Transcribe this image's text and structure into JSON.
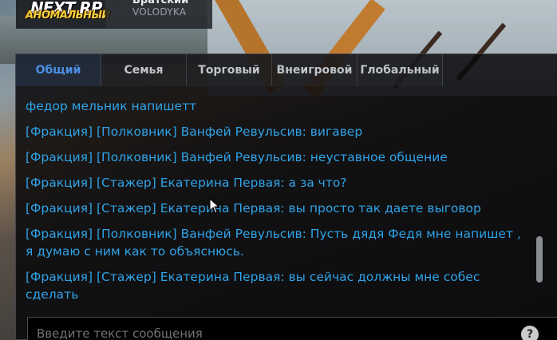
{
  "server": {
    "logo_top": "NEXT RP",
    "logo_bottom": "АНОМАЛЬНЫЙ",
    "name": "Братский",
    "user": "VOLODYKA"
  },
  "chat": {
    "tabs": [
      {
        "label": "Общий",
        "active": true
      },
      {
        "label": "Семья",
        "active": false
      },
      {
        "label": "Торговый",
        "active": false
      },
      {
        "label": "Внеигровой",
        "active": false
      },
      {
        "label": "Глобальный",
        "active": false
      }
    ],
    "messages": [
      "федор мельник напишетт",
      "[Фракция] [Полковник] Ванфей Ревульсив: вигавер",
      "[Фракция] [Полковник] Ванфей Ревульсив: неуставное общение",
      "[Фракция] [Стажер] Екатерина Первая: а за что?",
      "[Фракция] [Стажер] Екатерина Первая: вы просто так даете выговор",
      "[Фракция] [Полковник] Ванфей Ревульсив: Пусть дядя Федя мне напишет , я думаю с ним как то объяснюсь.",
      "[Фракция] [Стажер] Екатерина Первая: вы сейчас должны мне собес сделать"
    ],
    "input_placeholder": "Введите текст сообщения",
    "help_label": "?"
  },
  "colors": {
    "message_text": "#2fa3e8",
    "active_tab": "#4d8fe6",
    "logo_accent": "#f7d23a"
  },
  "icons": {
    "help": "question-icon",
    "cursor": "mouse-pointer-icon"
  }
}
